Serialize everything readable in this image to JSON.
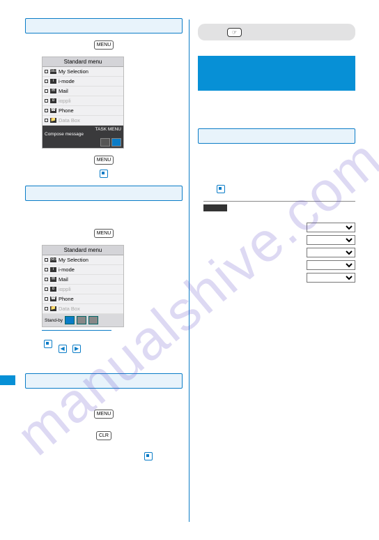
{
  "watermark": "manualshive.com",
  "left": {
    "phone_title": "Standard menu",
    "menu_items": [
      {
        "icon": "SEL",
        "label": "My Selection"
      },
      {
        "icon": "i",
        "label": "i-mode"
      },
      {
        "icon": "✉",
        "label": "Mail"
      },
      {
        "icon": "α",
        "label": "iαppli",
        "dim": true
      },
      {
        "icon": "☎",
        "label": "Phone"
      },
      {
        "icon": "📁",
        "label": "Data Box",
        "dim": true
      }
    ],
    "foot1_label": "TASK MENU",
    "foot1_sub": "Compose message",
    "foot2_label": "Stand-by",
    "btn_menu": "MENU",
    "btn_clr": "CLR",
    "arrow_left": "◀",
    "arrow_right": "▶"
  },
  "right": {
    "key_label": "☞",
    "select_opts": [
      "",
      "",
      "",
      "",
      ""
    ]
  }
}
